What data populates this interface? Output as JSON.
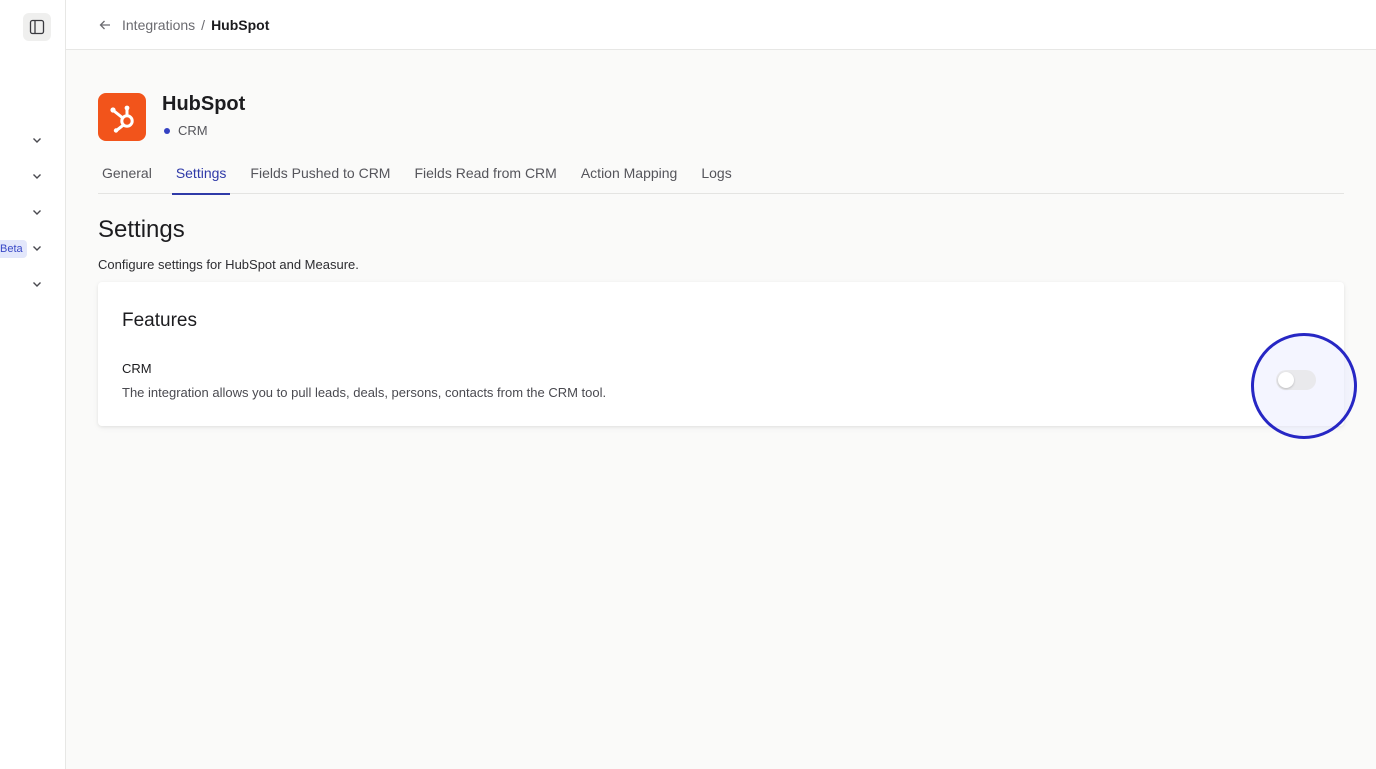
{
  "breadcrumb": {
    "parent": "Integrations",
    "separator": "/",
    "current": "HubSpot"
  },
  "sidebar": {
    "beta_label": "Beta",
    "toggle_icon": "sidebar-panel-icon",
    "chevron_icon": "chevron-down-icon"
  },
  "app": {
    "name": "HubSpot",
    "category": "CRM",
    "logo_icon": "hubspot-logo",
    "brand_color": "#f2541b"
  },
  "tabs": [
    {
      "label": "General",
      "active": false
    },
    {
      "label": "Settings",
      "active": true
    },
    {
      "label": "Fields Pushed to CRM",
      "active": false
    },
    {
      "label": "Fields Read from CRM",
      "active": false
    },
    {
      "label": "Action Mapping",
      "active": false
    },
    {
      "label": "Logs",
      "active": false
    }
  ],
  "settings": {
    "title": "Settings",
    "description": "Configure settings for HubSpot and Measure."
  },
  "features_card": {
    "title": "Features",
    "items": [
      {
        "name": "CRM",
        "description": "The integration allows you to pull leads, deals, persons, contacts from the CRM tool.",
        "enabled": false
      }
    ]
  },
  "colors": {
    "accent": "#2f3aa8",
    "highlight_ring": "#2727c4"
  }
}
